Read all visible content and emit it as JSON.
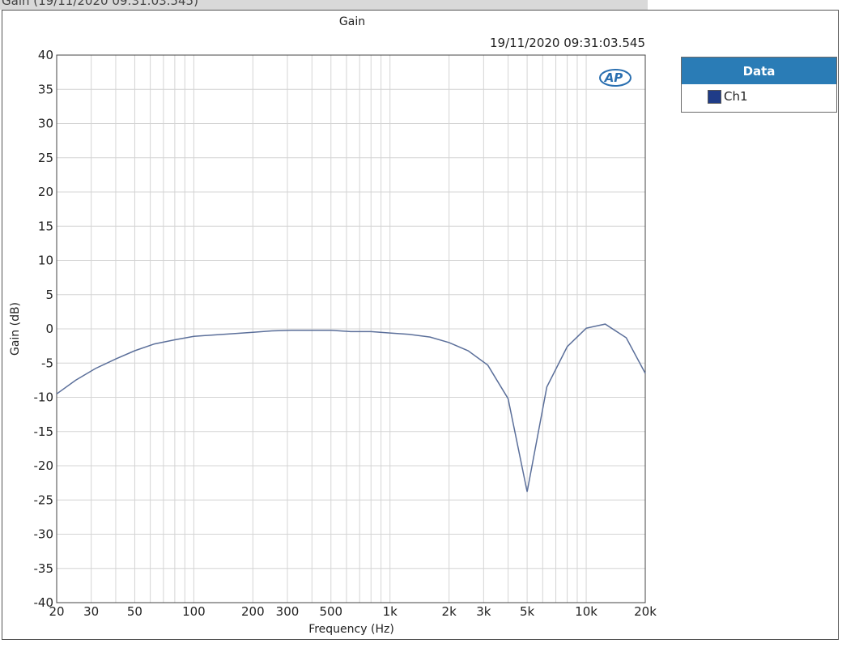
{
  "window": {
    "tab_title": "Gain (19/11/2020 09:31:03.545)"
  },
  "colors": {
    "series_line": "#5b6f9a",
    "legend_swatch": "#1f3c88",
    "legend_header": "#2a7cb6",
    "grid": "#d4d4d4",
    "logo": "#2a6fb0"
  },
  "logo": {
    "text": "AP",
    "icon": "audio-precision-logo"
  },
  "legend": {
    "header": "Data",
    "items": [
      {
        "label": "Ch1"
      }
    ]
  },
  "chart_data": {
    "type": "line",
    "title": "Gain",
    "timestamp": "19/11/2020 09:31:03.545",
    "xlabel": "Frequency (Hz)",
    "ylabel": "Gain (dB)",
    "xscale": "log",
    "xlim": [
      20,
      20000
    ],
    "ylim": [
      -40,
      40
    ],
    "grid": true,
    "legend_position": "outside-right",
    "xticks": [
      {
        "value": 20,
        "label": "20"
      },
      {
        "value": 30,
        "label": "30"
      },
      {
        "value": 50,
        "label": "50"
      },
      {
        "value": 100,
        "label": "100"
      },
      {
        "value": 200,
        "label": "200"
      },
      {
        "value": 300,
        "label": "300"
      },
      {
        "value": 500,
        "label": "500"
      },
      {
        "value": 1000,
        "label": "1k"
      },
      {
        "value": 2000,
        "label": "2k"
      },
      {
        "value": 3000,
        "label": "3k"
      },
      {
        "value": 5000,
        "label": "5k"
      },
      {
        "value": 10000,
        "label": "10k"
      },
      {
        "value": 20000,
        "label": "20k"
      }
    ],
    "yticks": [
      {
        "value": 40,
        "label": "40"
      },
      {
        "value": 35,
        "label": "35"
      },
      {
        "value": 30,
        "label": "30"
      },
      {
        "value": 25,
        "label": "25"
      },
      {
        "value": 20,
        "label": "20"
      },
      {
        "value": 15,
        "label": "15"
      },
      {
        "value": 10,
        "label": "10"
      },
      {
        "value": 5,
        "label": "5"
      },
      {
        "value": 0,
        "label": "0"
      },
      {
        "value": -5,
        "label": "-5"
      },
      {
        "value": -10,
        "label": "-10"
      },
      {
        "value": -15,
        "label": "-15"
      },
      {
        "value": -20,
        "label": "-20"
      },
      {
        "value": -25,
        "label": "-25"
      },
      {
        "value": -30,
        "label": "-30"
      },
      {
        "value": -35,
        "label": "-35"
      },
      {
        "value": -40,
        "label": "-40"
      }
    ],
    "series": [
      {
        "name": "Ch1",
        "x": [
          20,
          25,
          31.5,
          40,
          50,
          63,
          80,
          100,
          125,
          160,
          200,
          250,
          315,
          400,
          500,
          630,
          800,
          1000,
          1250,
          1600,
          2000,
          2500,
          3150,
          4000,
          5000,
          6300,
          8000,
          10000,
          12500,
          16000,
          20000
        ],
        "y": [
          -9.5,
          -7.5,
          -5.8,
          -4.4,
          -3.2,
          -2.2,
          -1.6,
          -1.1,
          -0.9,
          -0.7,
          -0.5,
          -0.3,
          -0.2,
          -0.2,
          -0.2,
          -0.4,
          -0.4,
          -0.6,
          -0.8,
          -1.2,
          -2.0,
          -3.2,
          -5.3,
          -10.2,
          -23.8,
          -8.5,
          -2.6,
          0.1,
          0.7,
          -1.3,
          -6.5
        ]
      }
    ]
  }
}
